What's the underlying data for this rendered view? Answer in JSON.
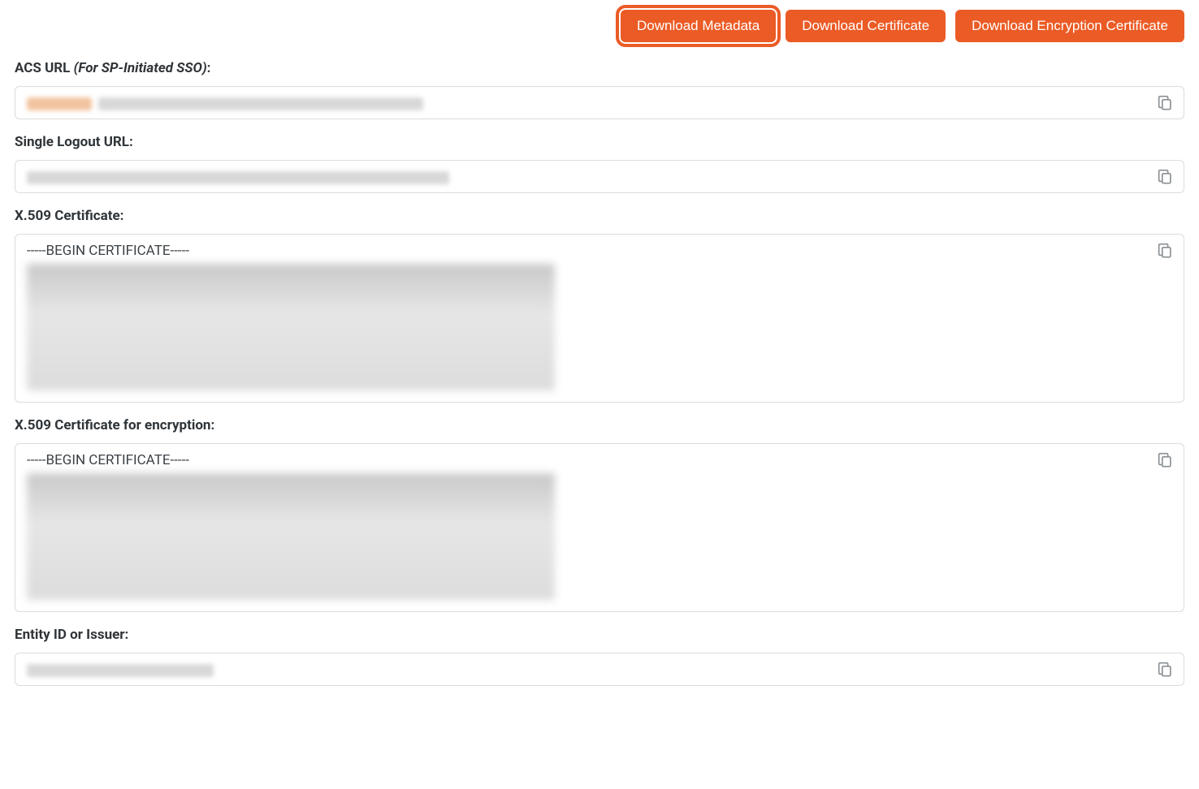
{
  "buttons": {
    "download_metadata": "Download Metadata",
    "download_certificate": "Download Certificate",
    "download_encryption_certificate": "Download Encryption Certificate"
  },
  "fields": {
    "acs_url": {
      "label_main": "ACS URL ",
      "label_hint": "(For SP-Initiated SSO)",
      "label_end": ":",
      "value": ""
    },
    "slo_url": {
      "label": "Single Logout URL:",
      "value": ""
    },
    "x509_cert": {
      "label": "X.509 Certificate:",
      "begin_line": "-----BEGIN CERTIFICATE-----",
      "value": ""
    },
    "x509_cert_enc": {
      "label": "X.509 Certificate for encryption:",
      "begin_line": "-----BEGIN CERTIFICATE-----",
      "value": ""
    },
    "entity_id": {
      "label": "Entity ID or Issuer:",
      "value": ""
    }
  }
}
